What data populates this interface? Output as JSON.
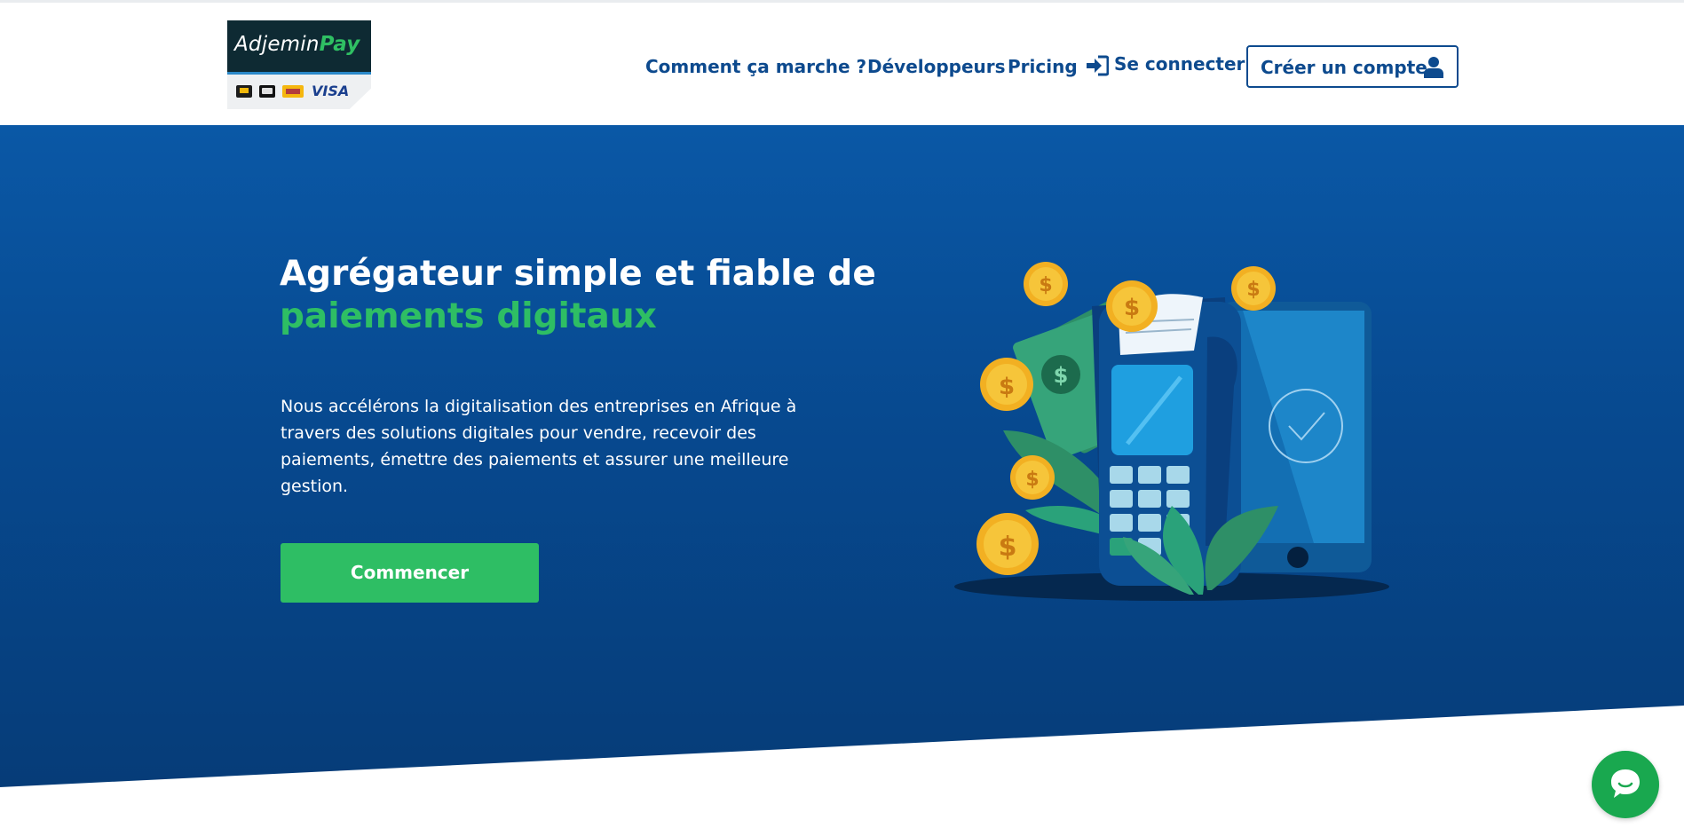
{
  "brand": {
    "logo_main": "Adjemin",
    "logo_accent": "Pay",
    "logo_card_text": "VISA"
  },
  "nav": {
    "how_it_works": "Comment ça marche ?",
    "developers": "Développeurs",
    "pricing": "Pricing",
    "login": "Se connecter",
    "create_account": "Créer un compte",
    "login_icon": "sign-in-icon",
    "account_icon": "user-icon"
  },
  "hero": {
    "title_line1": "Agrégateur simple et fiable de",
    "title_line2": "paiements digitaux",
    "description": "Nous accélérons la digitalisation des entreprises en Afrique à travers des solutions digitales pour vendre, recevoir des paiements, émettre des paiements et assurer une meilleure gestion.",
    "cta": "Commencer",
    "illustration": "payment-terminal-illustration"
  },
  "chat": {
    "icon": "chat-bubble-icon"
  },
  "colors": {
    "primary_blue": "#0d4a8e",
    "hero_blue": "#07498f",
    "accent_green": "#2ebe64",
    "chat_green": "#19a84f"
  }
}
